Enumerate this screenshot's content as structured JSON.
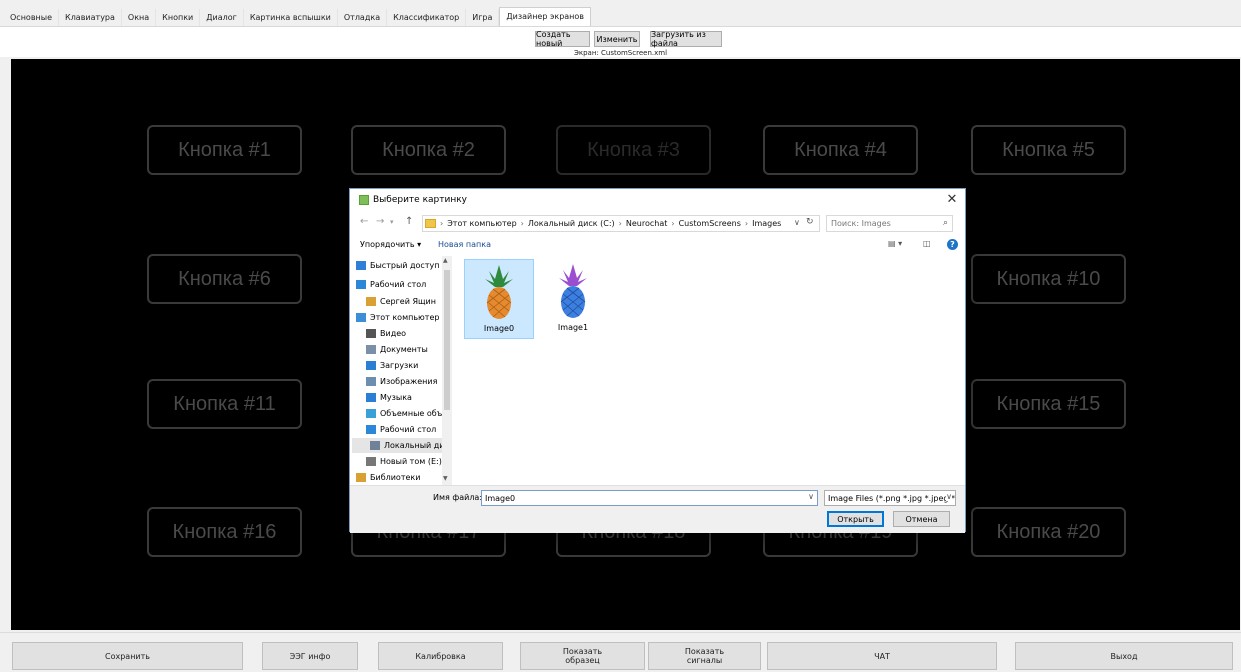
{
  "tabs": [
    "Основные",
    "Клавиатура",
    "Окна",
    "Кнопки",
    "Диалог",
    "Картинка вспышки",
    "Отладка",
    "Классификатор",
    "Игра",
    "Дизайнер экранов"
  ],
  "active_tab": "Дизайнер экранов",
  "toolbar": {
    "create_label": "Создать новый",
    "edit_label": "Изменить",
    "load_label": "Загрузить из файла",
    "screen_caption": "Экран: CustomScreen.xml"
  },
  "canvas_buttons": [
    "Кнопка #1",
    "Кнопка #2",
    "Кнопка #3",
    "Кнопка #4",
    "Кнопка #5",
    "Кнопка #6",
    "Кнопка #10",
    "Кнопка #11",
    "Кнопка #15",
    "Кнопка #16",
    "Кнопка #17",
    "Кнопка #18",
    "Кнопка #19",
    "Кнопка #20"
  ],
  "bottom_bar": {
    "save": "Сохранить",
    "eeg_info": "ЭЭГ инфо",
    "calibration": "Калибровка",
    "show_sample": "Показать\nобразец",
    "show_signals": "Показать\nсигналы",
    "chat": "ЧАТ",
    "exit": "Выход"
  },
  "dialog": {
    "title": "Выберите картинку",
    "breadcrumb": [
      "Этот компьютер",
      "Локальный диск (C:)",
      "Neurochat",
      "CustomScreens",
      "Images"
    ],
    "search_placeholder": "Поиск: Images",
    "organize": "Упорядочить ▾",
    "new_folder": "Новая папка",
    "nav_items": [
      {
        "label": "Быстрый доступ",
        "icon": "star-icon",
        "color": "#2f7fd8"
      },
      {
        "label": "Рабочий стол",
        "icon": "desktop-icon",
        "color": "#2b88d8"
      },
      {
        "label": "Сергей Ящин",
        "icon": "user-icon",
        "color": "#d9a034"
      },
      {
        "label": "Этот компьютер",
        "icon": "computer-icon",
        "color": "#3c8fd6"
      },
      {
        "label": "Видео",
        "icon": "video-icon",
        "color": "#555555"
      },
      {
        "label": "Документы",
        "icon": "documents-icon",
        "color": "#7b8fa8"
      },
      {
        "label": "Загрузки",
        "icon": "downloads-icon",
        "color": "#2a7fd4"
      },
      {
        "label": "Изображения",
        "icon": "pictures-icon",
        "color": "#6c8fb0"
      },
      {
        "label": "Музыка",
        "icon": "music-icon",
        "color": "#2a7fd4"
      },
      {
        "label": "Объемные объекты",
        "icon": "3d-objects-icon",
        "color": "#3aa0d8"
      },
      {
        "label": "Рабочий стол",
        "icon": "desktop-icon",
        "color": "#2b88d8"
      },
      {
        "label": "Локальный диск (C:)",
        "icon": "local-disk-icon",
        "color": "#6f8297"
      },
      {
        "label": "Новый том (E:)",
        "icon": "drive-icon",
        "color": "#777777"
      },
      {
        "label": "Библиотеки",
        "icon": "libraries-icon",
        "color": "#d9a034"
      }
    ],
    "files": [
      {
        "name": "Image0",
        "selected": true,
        "colors": {
          "body": "#e58a2e",
          "leaves": "#2e8b3e"
        }
      },
      {
        "name": "Image1",
        "selected": false,
        "colors": {
          "body": "#3d7fe0",
          "leaves": "#9b4fd0"
        }
      }
    ],
    "filename_label": "Имя файла:",
    "filename_value": "Image0",
    "filter_value": "Image Files (*.png *.jpg *.jpeg *",
    "open_label": "Открыть",
    "cancel_label": "Отмена"
  },
  "colors": {
    "canvas": "#000000",
    "selection": "#cce8ff",
    "accent": "#0078d7"
  }
}
